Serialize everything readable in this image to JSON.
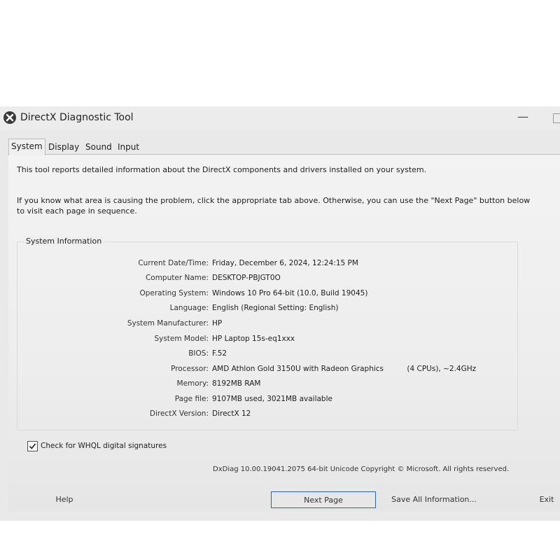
{
  "window": {
    "title": "DirectX Diagnostic Tool",
    "minimize_glyph": "—"
  },
  "tabs": [
    {
      "label": "System",
      "active": true
    },
    {
      "label": "Display",
      "active": false
    },
    {
      "label": "Sound",
      "active": false
    },
    {
      "label": "Input",
      "active": false
    }
  ],
  "intro": {
    "line1": "This tool reports detailed information about the DirectX components and drivers installed on your system.",
    "line2": "If you know what area is causing the problem, click the appropriate tab above.  Otherwise, you can use the \"Next Page\" button below to visit each page in sequence."
  },
  "system_info": {
    "title": "System Information",
    "rows": [
      {
        "label": "Current Date/Time:",
        "value": "Friday, December 6, 2024, 12:24:15 PM"
      },
      {
        "label": "Computer Name:",
        "value": "DESKTOP-PBJGT0O"
      },
      {
        "label": "Operating System:",
        "value": "Windows 10 Pro 64-bit (10.0, Build 19045)"
      },
      {
        "label": "Language:",
        "value": "English (Regional Setting: English)"
      },
      {
        "label": "System Manufacturer:",
        "value": "HP"
      },
      {
        "label": "System Model:",
        "value": "HP Laptop 15s-eq1xxx"
      },
      {
        "label": "BIOS:",
        "value": "F.52"
      },
      {
        "label": "Processor:",
        "value": "AMD Athlon Gold 3150U with Radeon Graphics          (4 CPUs), ~2.4GHz"
      },
      {
        "label": "Memory:",
        "value": "8192MB RAM"
      },
      {
        "label": "Page file:",
        "value": "9107MB used, 3021MB available"
      },
      {
        "label": "DirectX Version:",
        "value": "DirectX 12"
      }
    ]
  },
  "whql_checkbox": {
    "label": "Check for WHQL digital signatures",
    "checked": true
  },
  "footer": {
    "copyright": "DxDiag 10.00.19041.2075 64-bit Unicode  Copyright © Microsoft. All rights reserved."
  },
  "buttons": {
    "help": "Help",
    "next_page": "Next Page",
    "save_all": "Save All Information...",
    "exit": "Exit"
  },
  "icons": {
    "app": "directx-icon",
    "check": "checkmark-icon"
  },
  "colors": {
    "focus_border": "#2c63b8",
    "window_bg": "#e9e9e9"
  }
}
